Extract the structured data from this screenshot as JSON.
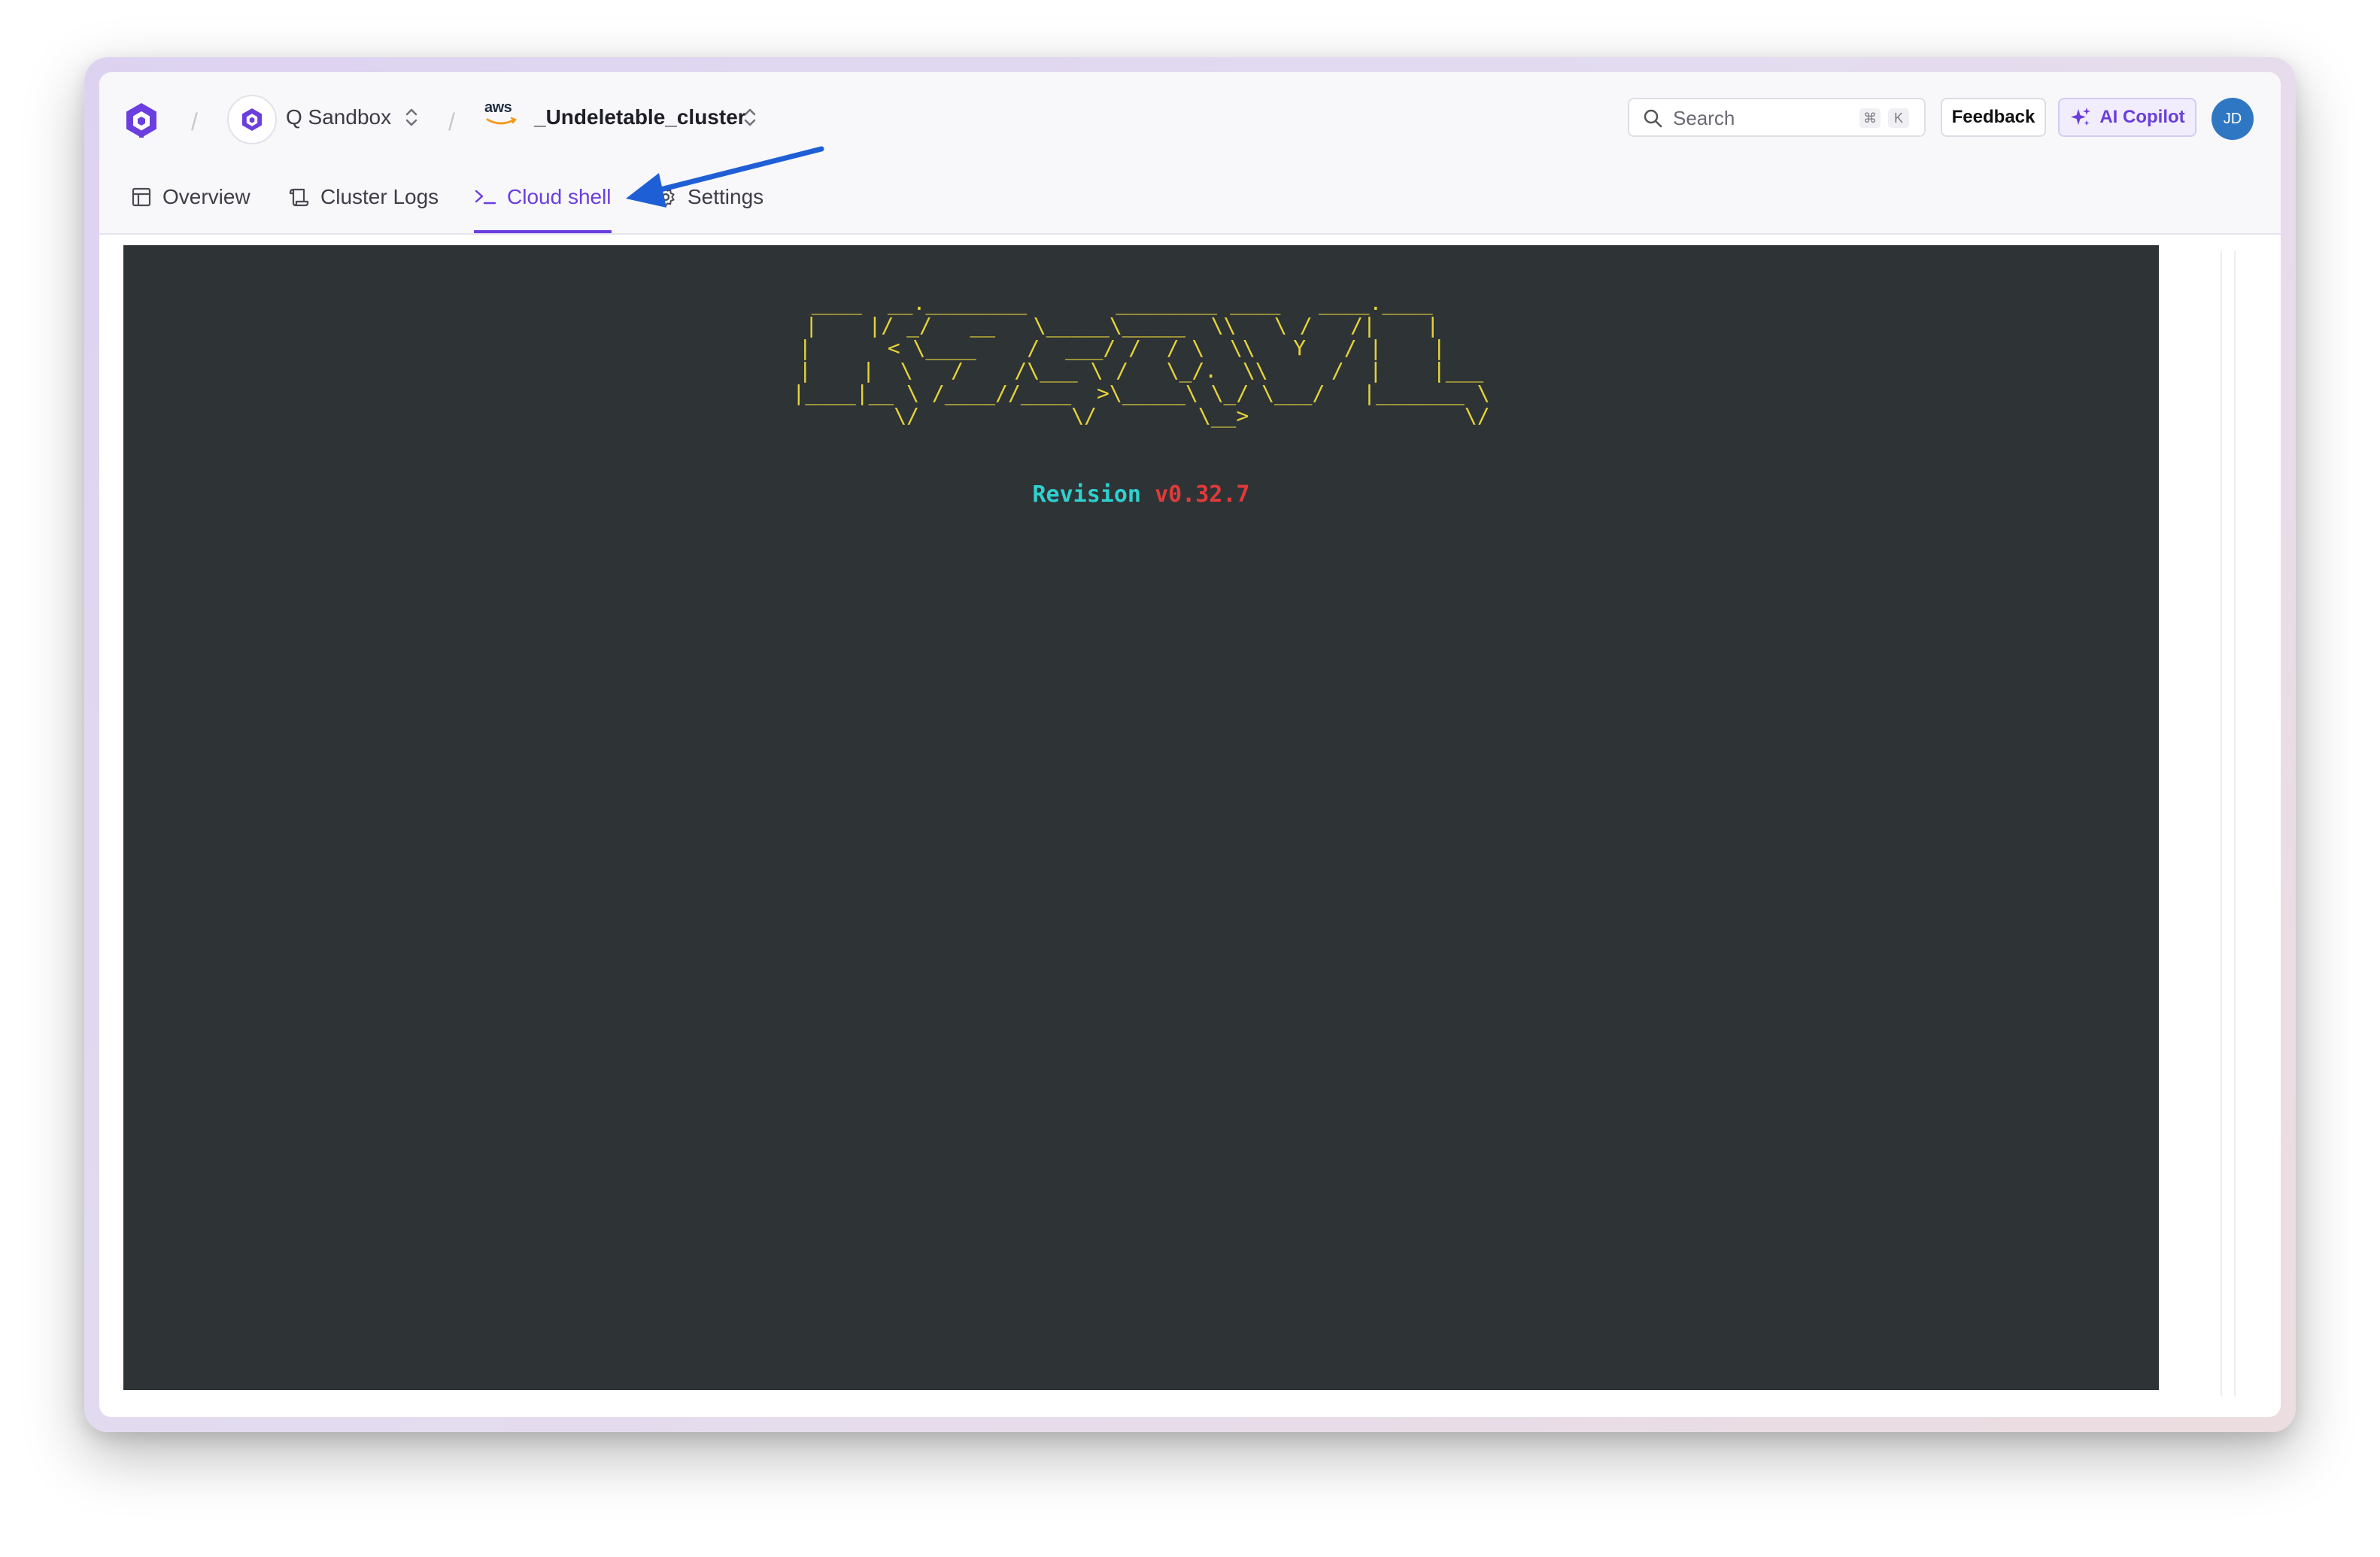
{
  "header": {
    "org": {
      "name": "Q Sandbox"
    },
    "cluster": {
      "provider_logo_text": "aws",
      "name": "_Undeletable_cluster"
    },
    "search": {
      "placeholder": "Search",
      "shortcut": [
        "⌘",
        "K"
      ]
    },
    "feedback_label": "Feedback",
    "copilot_label": "AI Copilot",
    "user_initials": "JD"
  },
  "tabs": [
    {
      "label": "Overview",
      "icon": "layout-icon",
      "active": false
    },
    {
      "label": "Cluster Logs",
      "icon": "scroll-icon",
      "active": false
    },
    {
      "label": "Cloud shell",
      "icon": "terminal-icon",
      "active": true
    },
    {
      "label": "Settings",
      "icon": "gear-icon",
      "active": false
    }
  ],
  "terminal": {
    "ascii_banner": " ____  __.________       ________ ____   ____.____    \n|    |/ _/   __   \\_____\\_____  \\\\   \\ /   /|    |   \n|      < \\____    /  ___/ /  / \\  \\\\   Y   / |    |   \n|    |  \\   /    /\\___ \\ /   \\_/.  \\\\     /  |    |___\n|____|__ \\ /____//____  >\\_____\\ \\_/ \\___/   |_______ \\\n        \\/            \\/        \\__>                 \\/",
    "revision_label": "Revision",
    "revision_version": "v0.32.7"
  },
  "colors": {
    "accent": "#6b3ee0",
    "terminal_bg": "#2e3336",
    "banner": "#e6d33a",
    "revision_label": "#2fd0cf",
    "revision_version": "#e03a3a",
    "annotation_arrow": "#1f5fd6"
  }
}
